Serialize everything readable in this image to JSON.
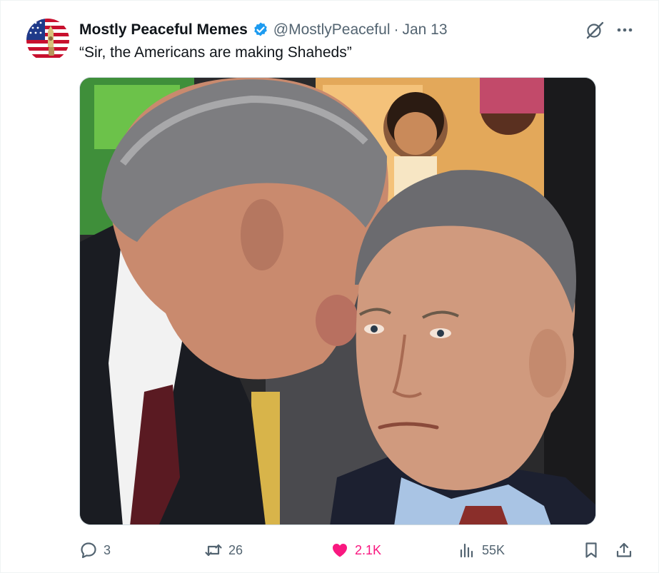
{
  "author": {
    "display_name": "Mostly Peaceful Memes",
    "handle": "@MostlyPeaceful",
    "separator": "·",
    "date": "Jan 13",
    "verified": true,
    "avatar_icon": "flag-avatar-icon"
  },
  "post": {
    "text": "“Sir, the Americans are making Shaheds”",
    "media_description_icon": "photo-image"
  },
  "actions": {
    "replies": "3",
    "reposts": "26",
    "likes": "2.1K",
    "views": "55K"
  },
  "colors": {
    "text_primary": "#0f1419",
    "text_secondary": "#536471",
    "verified_blue": "#1d9bf0",
    "like_pink": "#f91880"
  }
}
